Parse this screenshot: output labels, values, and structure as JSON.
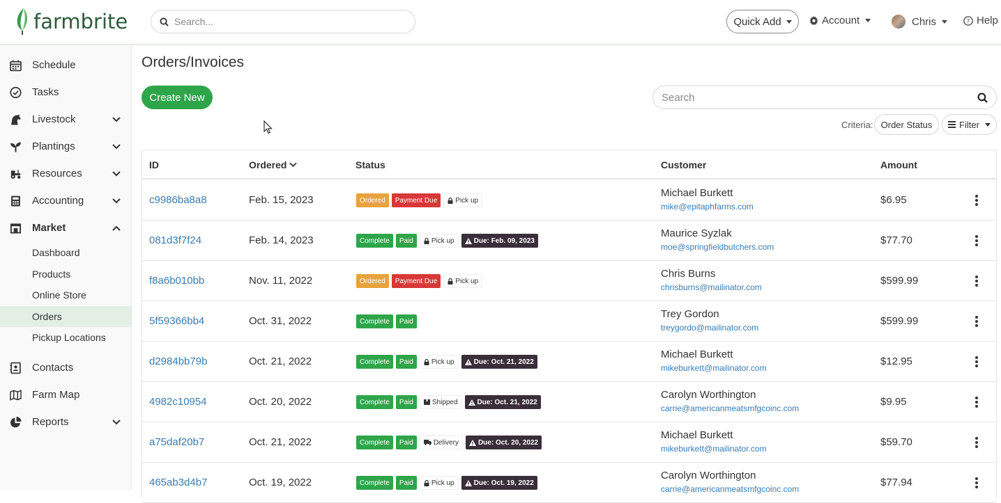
{
  "brand": {
    "name": "farmbrite",
    "accent": "#2fa54a",
    "link": "#3a7bb0",
    "dark_badge": "#3a2e3a"
  },
  "header": {
    "search_placeholder": "Search...",
    "quick_add": "Quick Add",
    "account": "Account",
    "user": "Chris",
    "help": "Help"
  },
  "sidebar": {
    "items": [
      {
        "label": "Schedule",
        "icon": "calendar-icon"
      },
      {
        "label": "Tasks",
        "icon": "check-circle-icon"
      },
      {
        "label": "Livestock",
        "icon": "horse-icon"
      },
      {
        "label": "Plantings",
        "icon": "seedling-icon"
      },
      {
        "label": "Resources",
        "icon": "tractor-icon"
      },
      {
        "label": "Accounting",
        "icon": "calculator-icon"
      },
      {
        "label": "Market",
        "icon": "store-icon"
      }
    ],
    "market_sub": [
      "Dashboard",
      "Products",
      "Online Store",
      "Orders",
      "Pickup Locations"
    ],
    "bottom_items": [
      {
        "label": "Contacts",
        "icon": "address-book-icon"
      },
      {
        "label": "Farm Map",
        "icon": "map-icon"
      },
      {
        "label": "Reports",
        "icon": "pie-chart-icon"
      }
    ]
  },
  "page": {
    "title": "Orders/Invoices",
    "create_new": "Create New",
    "search_placeholder": "Search",
    "criteria_label": "Criteria:",
    "order_status": "Order Status",
    "filter": "Filter"
  },
  "table": {
    "headers": {
      "id": "ID",
      "ordered": "Ordered",
      "status": "Status",
      "customer": "Customer",
      "amount": "Amount"
    },
    "rows": [
      {
        "id": "c9986ba8a8",
        "date": "Feb. 15, 2023",
        "s1": "Ordered",
        "s2": "Payment Due",
        "ship": "Pick up",
        "due": "",
        "name": "Michael Burkett",
        "email": "mike@epitaphfarms.com",
        "amount": "$6.95"
      },
      {
        "id": "081d3f7f24",
        "date": "Feb. 14, 2023",
        "s1": "Complete",
        "s2": "Paid",
        "ship": "Pick up",
        "due": "Due: Feb. 09, 2023",
        "name": "Maurice Syzlak",
        "email": "moe@springfieldbutchers.com",
        "amount": "$77.70"
      },
      {
        "id": "f8a6b010bb",
        "date": "Nov. 11, 2022",
        "s1": "Ordered",
        "s2": "Payment Due",
        "ship": "Pick up",
        "due": "",
        "name": "Chris Burns",
        "email": "chrisburns@mailinator.com",
        "amount": "$599.99"
      },
      {
        "id": "5f59366bb4",
        "date": "Oct. 31, 2022",
        "s1": "Complete",
        "s2": "Paid",
        "ship": "",
        "due": "",
        "name": "Trey Gordon",
        "email": "treygordo@mailinator.com",
        "amount": "$599.99"
      },
      {
        "id": "d2984bb79b",
        "date": "Oct. 21, 2022",
        "s1": "Complete",
        "s2": "Paid",
        "ship": "Pick up",
        "due": "Due: Oct. 21, 2022",
        "name": "Michael Burkett",
        "email": "mikeburkett@mailinator.com",
        "amount": "$12.95"
      },
      {
        "id": "4982c10954",
        "date": "Oct. 20, 2022",
        "s1": "Complete",
        "s2": "Paid",
        "ship": "Shipped",
        "due": "Due: Oct. 21, 2022",
        "name": "Carolyn Worthington",
        "email": "carrie@americanmeatsmfgcoinc.com",
        "amount": "$9.95"
      },
      {
        "id": "a75daf20b7",
        "date": "Oct. 21, 2022",
        "s1": "Complete",
        "s2": "Paid",
        "ship": "Delivery",
        "due": "Due: Oct. 20, 2022",
        "name": "Michael Burkett",
        "email": "mikeburkett@mailinator.com",
        "amount": "$59.70"
      },
      {
        "id": "465ab3d4b7",
        "date": "Oct. 19, 2022",
        "s1": "Complete",
        "s2": "Paid",
        "ship": "Pick up",
        "due": "Due: Oct. 19, 2022",
        "name": "Carolyn Worthington",
        "email": "carrie@americanmeatsmfgcoinc.com",
        "amount": "$77.94"
      }
    ]
  }
}
